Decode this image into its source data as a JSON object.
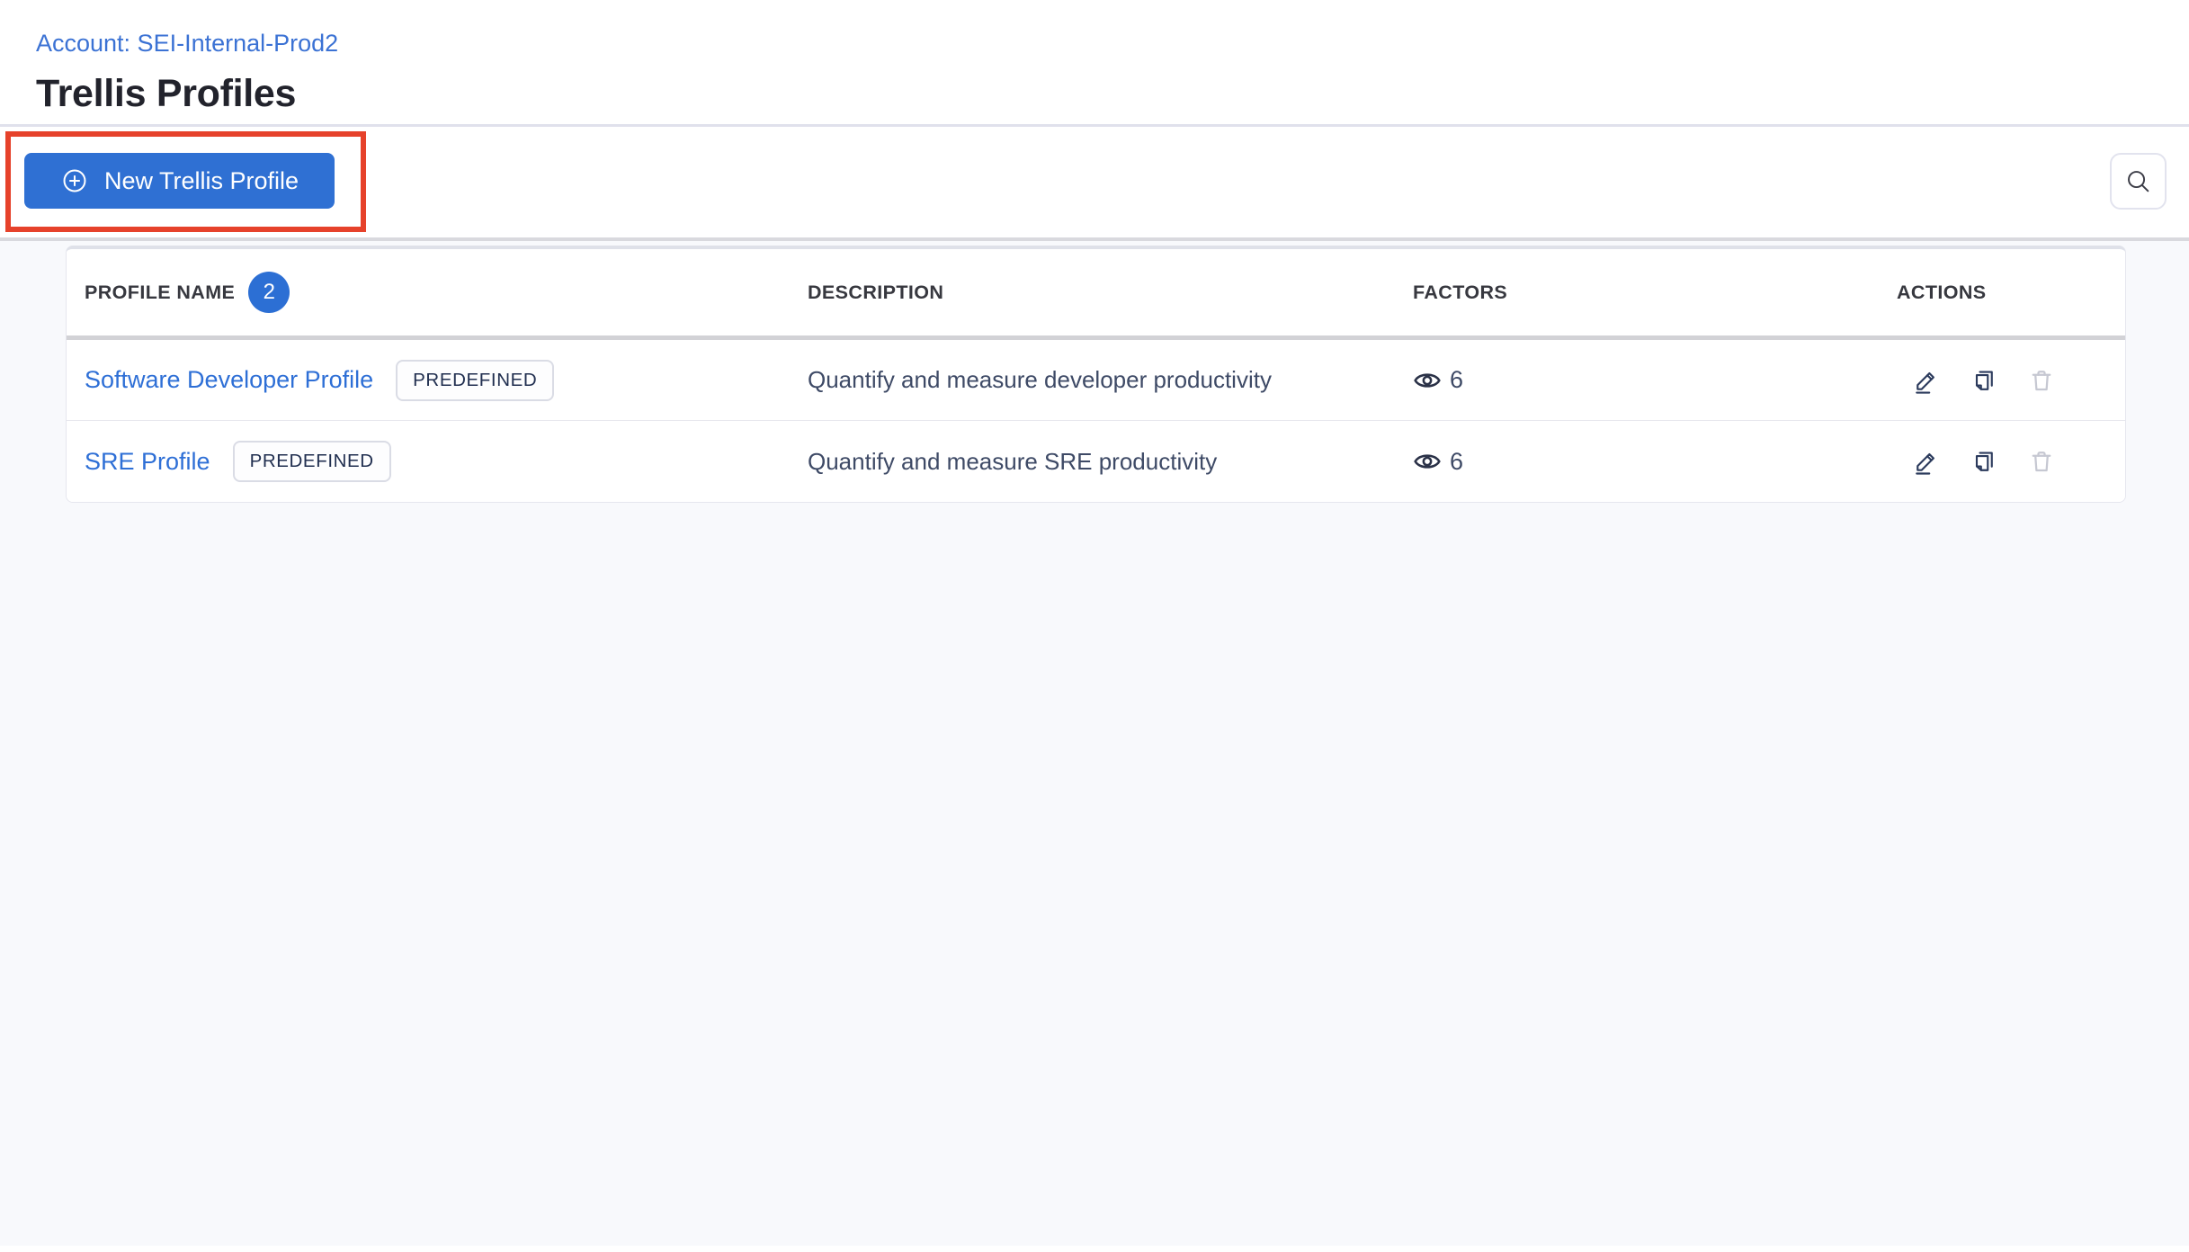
{
  "page": {
    "account_breadcrumb": "Account: SEI-Internal-Prod2",
    "title": "Trellis Profiles"
  },
  "toolbar": {
    "new_profile_button": "New Trellis Profile"
  },
  "table": {
    "columns": {
      "name": "PROFILE NAME",
      "name_count": "2",
      "description": "DESCRIPTION",
      "factors": "FACTORS",
      "actions": "ACTIONS"
    },
    "rows": [
      {
        "name": "Software Developer Profile",
        "tag": "PREDEFINED",
        "description": "Quantify and measure developer productivity",
        "factors": "6"
      },
      {
        "name": "SRE Profile",
        "tag": "PREDEFINED",
        "description": "Quantify and measure SRE productivity",
        "factors": "6"
      }
    ]
  },
  "icons": {
    "new_profile": "plus-circle-icon",
    "search": "search-icon",
    "factors": "eye-icon",
    "edit": "pencil-icon",
    "clone": "copy-icon",
    "delete": "trash-icon"
  },
  "colors": {
    "link_blue": "#2e6fd6",
    "button_blue": "#2f70d3",
    "badge_blue": "#2c6fd4",
    "annotation_red": "#e6422b",
    "text_dark": "#22232c",
    "text_navy": "#3e4a66",
    "icon_navy": "#2b3a5c",
    "disabled_gray": "#c6c8d2",
    "page_bg": "#f8f9fc"
  }
}
